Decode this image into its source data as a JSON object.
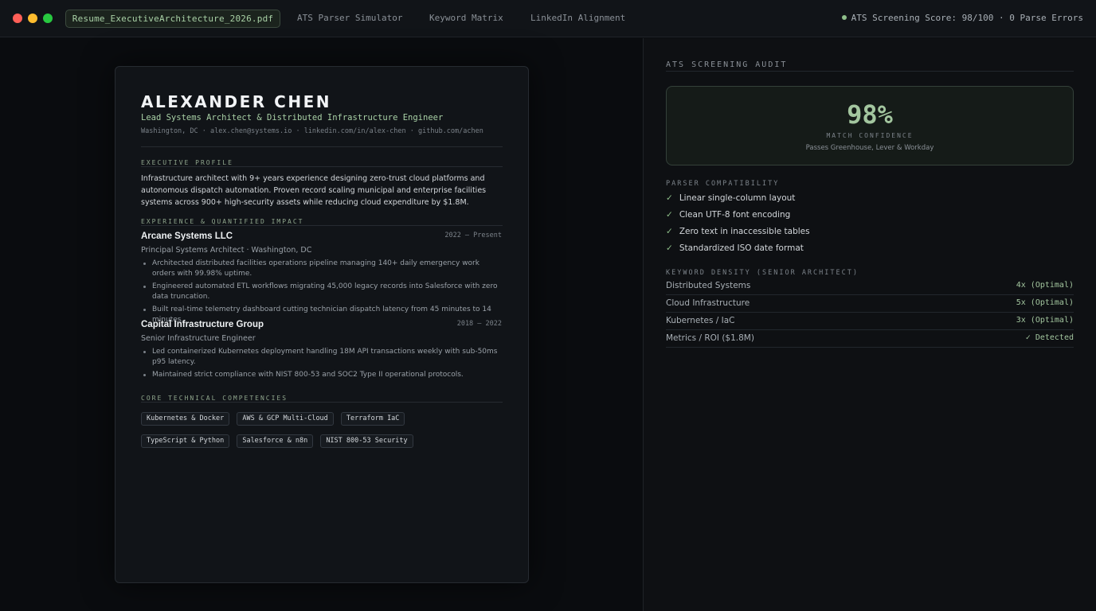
{
  "window": {
    "file_tab": "Resume_ExecutiveArchitecture_2026.pdf",
    "tabs": [
      "ATS Parser Simulator",
      "Keyword Matrix",
      "LinkedIn Alignment"
    ],
    "status": "ATS Screening Score: 98/100 · 0 Parse Errors"
  },
  "resume": {
    "name": "ALEXANDER CHEN",
    "role": "Lead Systems Architect & Distributed Infrastructure Engineer",
    "contact": "Washington, DC · alex.chen@systems.io · linkedin.com/in/alex-chen · github.com/achen",
    "profile_heading": "EXECUTIVE PROFILE",
    "profile": "Infrastructure architect with 9+ years experience designing zero-trust cloud platforms and autonomous dispatch automation. Proven record scaling municipal and enterprise facilities systems across 900+ high-security assets while reducing cloud expenditure by $1.8M.",
    "experience_heading": "EXPERIENCE & QUANTIFIED IMPACT",
    "jobs": [
      {
        "company": "Arcane Systems LLC",
        "dates": "2022 – Present",
        "title": "Principal Systems Architect · Washington, DC",
        "bullets": [
          "Architected distributed facilities operations pipeline managing 140+ daily emergency work orders with 99.98% uptime.",
          "Engineered automated ETL workflows migrating 45,000 legacy records into Salesforce with zero data truncation.",
          "Built real-time telemetry dashboard cutting technician dispatch latency from 45 minutes to 14 minutes."
        ]
      },
      {
        "company": "Capital Infrastructure Group",
        "dates": "2018 – 2022",
        "title": "Senior Infrastructure Engineer",
        "bullets": [
          "Led containerized Kubernetes deployment handling 18M API transactions weekly with sub-50ms p95 latency.",
          "Maintained strict compliance with NIST 800-53 and SOC2 Type II operational protocols."
        ]
      }
    ],
    "competencies_heading": "CORE TECHNICAL COMPETENCIES",
    "competencies": [
      "Kubernetes & Docker",
      "AWS & GCP Multi-Cloud",
      "Terraform IaC",
      "TypeScript & Python",
      "Salesforce & n8n",
      "NIST 800-53 Security"
    ]
  },
  "audit": {
    "title": "ATS SCREENING AUDIT",
    "score": "98%",
    "score_caption": "MATCH CONFIDENCE",
    "score_sub": "Passes Greenhouse, Lever & Workday",
    "compat_heading": "PARSER COMPATIBILITY",
    "check_glyph": "✓",
    "compat": [
      "Linear single-column layout",
      "Clean UTF-8 font encoding",
      "Zero text in inaccessible tables",
      "Standardized ISO date format"
    ],
    "density_heading": "KEYWORD DENSITY (SENIOR ARCHITECT)",
    "density": [
      {
        "label": "Distributed Systems",
        "value": "4x (Optimal)"
      },
      {
        "label": "Cloud Infrastructure",
        "value": "5x (Optimal)"
      },
      {
        "label": "Kubernetes / IaC",
        "value": "3x (Optimal)"
      },
      {
        "label": "Metrics / ROI ($1.8M)",
        "value": "✓ Detected"
      }
    ]
  }
}
